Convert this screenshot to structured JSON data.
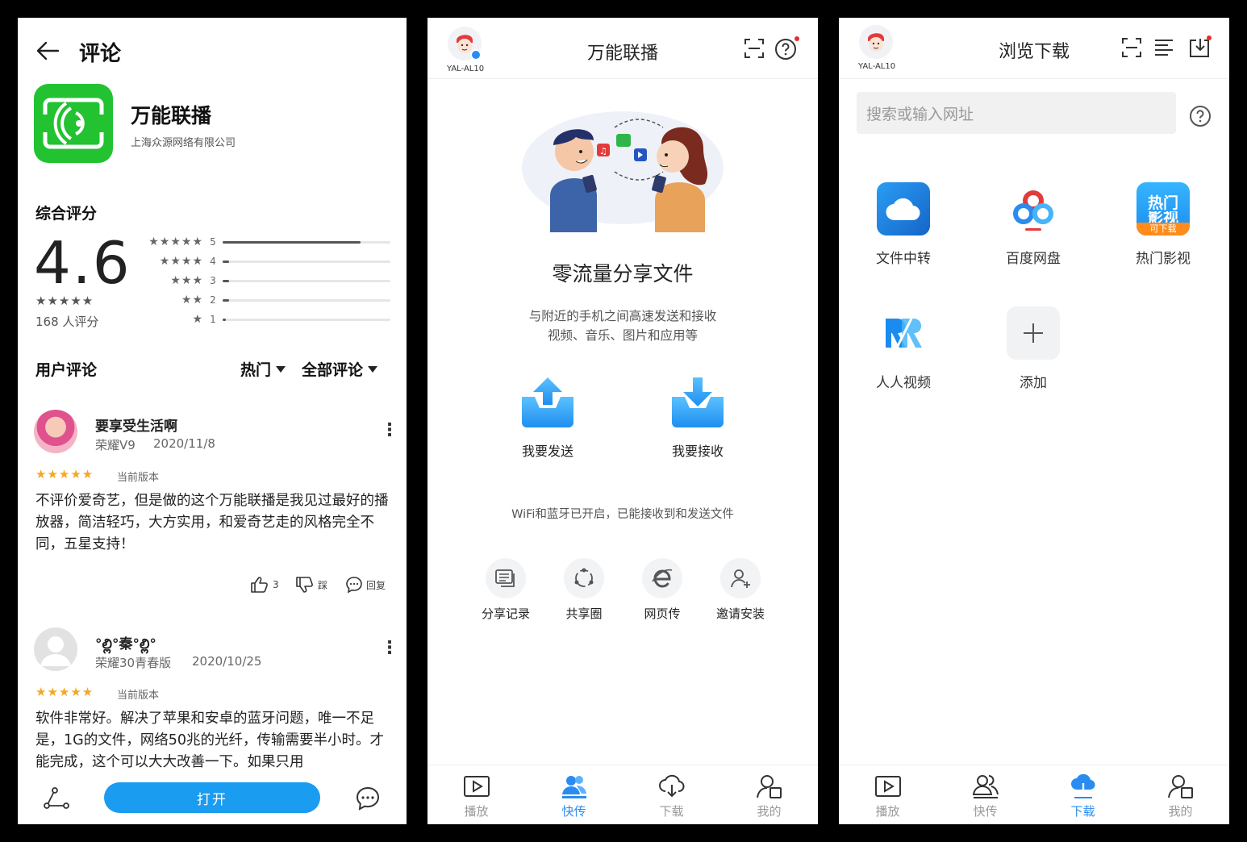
{
  "panel1": {
    "title": "评论",
    "app_name": "万能联播",
    "developer": "上海众源网络有限公司",
    "overall_label": "综合评分",
    "rating": "4.6",
    "rating_stars": "★★★★★",
    "rating_count": "168 人评分",
    "distribution": [
      {
        "stars": "★★★★★",
        "label": "5",
        "fraction": 0.82
      },
      {
        "stars": "★★★★",
        "label": "4",
        "fraction": 0.04
      },
      {
        "stars": "★★★",
        "label": "3",
        "fraction": 0.04
      },
      {
        "stars": "★★",
        "label": "2",
        "fraction": 0.04
      },
      {
        "stars": "★",
        "label": "1",
        "fraction": 0.02
      }
    ],
    "reviews_label": "用户评论",
    "sort_hot": "热门",
    "sort_all": "全部评论",
    "reviews": [
      {
        "name": "要享受生活啊",
        "device": "荣耀V9",
        "date": "2020/11/8",
        "stars": "★★★★★",
        "version": "当前版本",
        "text": "不评价爱奇艺，但是做的这个万能联播是我见过最好的播放器，简洁轻巧，大方实用，和爱奇艺走的风格完全不同，五星支持！",
        "likes": "3",
        "dislike": "踩",
        "reply": "回复"
      },
      {
        "name": "°ల్లి°秦°ల్లి°",
        "device": "荣耀30青春版",
        "date": "2020/10/25",
        "stars": "★★★★★",
        "version": "当前版本",
        "text": "软件非常好。解决了苹果和安卓的蓝牙问题，唯一不足是，1G的文件，网络50兆的光纤，传输需要半小时。才能完成，这个可以大大改善一下。如果只用"
      }
    ],
    "open_button": "打开",
    "colors": {
      "app_green": "#22c230",
      "open_blue": "#1a9cf0",
      "star_orange": "#f5a623"
    }
  },
  "panel2": {
    "device": "YAL-AL10",
    "title": "万能联播",
    "headline": "零流量分享文件",
    "subtitle_line1": "与附近的手机之间高速发送和接收",
    "subtitle_line2": "视频、音乐、图片和应用等",
    "send_label": "我要发送",
    "receive_label": "我要接收",
    "status": "WiFi和蓝牙已开启，已能接收到和发送文件",
    "tools": [
      "分享记录",
      "共享圈",
      "网页传",
      "邀请安装"
    ],
    "tabs": [
      "播放",
      "快传",
      "下载",
      "我的"
    ],
    "active_tab": "快传"
  },
  "panel3": {
    "device": "YAL-AL10",
    "title": "浏览下载",
    "search_placeholder": "搜索或输入网址",
    "tiles": [
      "文件中转",
      "百度网盘",
      "热门影视",
      "人人视频",
      "添加"
    ],
    "hot_icon_text_top": "热门",
    "hot_icon_text_mid": "影视",
    "hot_icon_text_tag": "可下载",
    "tabs": [
      "播放",
      "快传",
      "下载",
      "我的"
    ],
    "active_tab": "下载"
  }
}
